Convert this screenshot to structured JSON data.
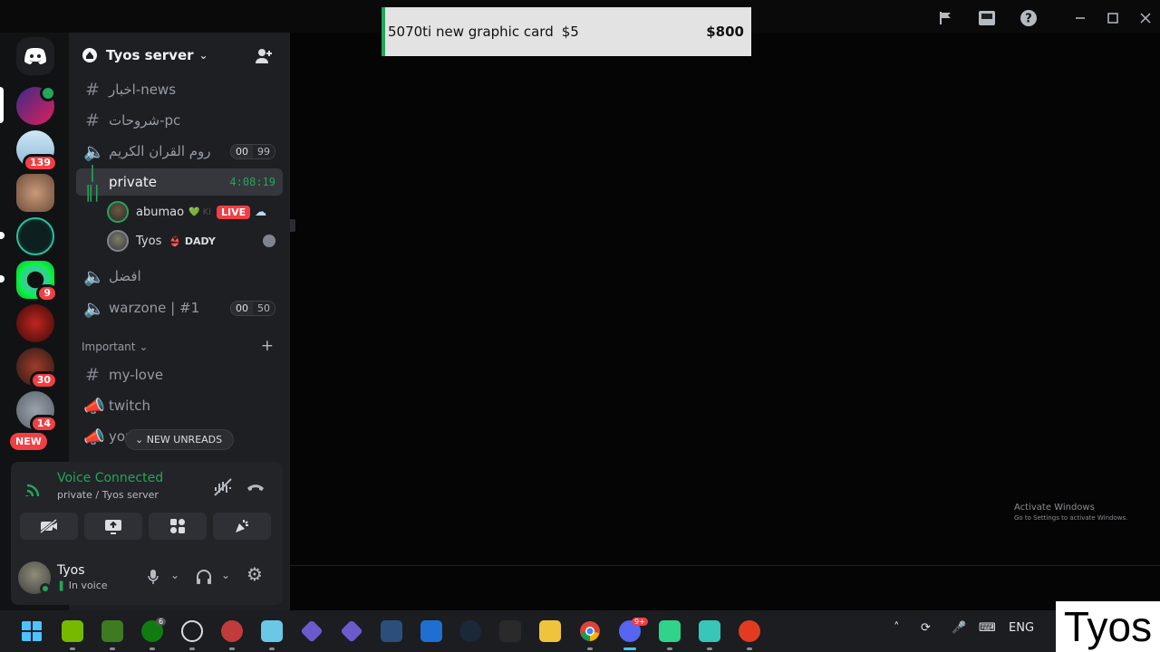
{
  "overlay_card": {
    "title": "5070ti new graphic card",
    "price_small": "$5",
    "price_large": "$800"
  },
  "server": {
    "name": "Tyos server"
  },
  "server_badges": {
    "s2": "139",
    "s5": "9",
    "s8": "30",
    "s9": "14",
    "new": "NEW"
  },
  "channels": [
    {
      "name": "اخبار-news",
      "type": "text"
    },
    {
      "name": "شروحات-pc",
      "type": "text"
    },
    {
      "name": "روم القران الكريم",
      "type": "voice",
      "count_a": "00",
      "count_b": "99"
    },
    {
      "name": "private",
      "type": "voice-active",
      "timer": "4:08:19"
    },
    {
      "name": "افضل",
      "type": "voice"
    },
    {
      "name": "warzone | #1",
      "type": "voice",
      "count_a": "00",
      "count_b": "50"
    }
  ],
  "voice_users": [
    {
      "name": "abumao",
      "tag": "💚 Ki",
      "live": "LIVE"
    },
    {
      "name": "Tyos",
      "tag": "👙 DADY"
    }
  ],
  "category": {
    "name": "Important"
  },
  "important_channels": [
    {
      "name": "my-love",
      "type": "text"
    },
    {
      "name": "twitch",
      "type": "announcement"
    },
    {
      "name": "you",
      "type": "announcement"
    }
  ],
  "new_unreads": "NEW UNREADS",
  "voice_panel": {
    "title": "Voice Connected",
    "subtitle": "private / Tyos server"
  },
  "user_panel": {
    "name": "Tyos",
    "status": "In voice"
  },
  "activate_windows": {
    "line1": "Activate Windows",
    "line2": "Go to Settings to activate Windows."
  },
  "taskbar": {
    "lang": "ENG",
    "discord_badge": "9+",
    "xbox_badge": "6"
  },
  "watermark": "Tyos",
  "colors": {
    "accent_green": "#23a55a",
    "danger": "#f23f43",
    "sidebar_bg": "#1e1f22",
    "rail_bg": "#111214"
  }
}
